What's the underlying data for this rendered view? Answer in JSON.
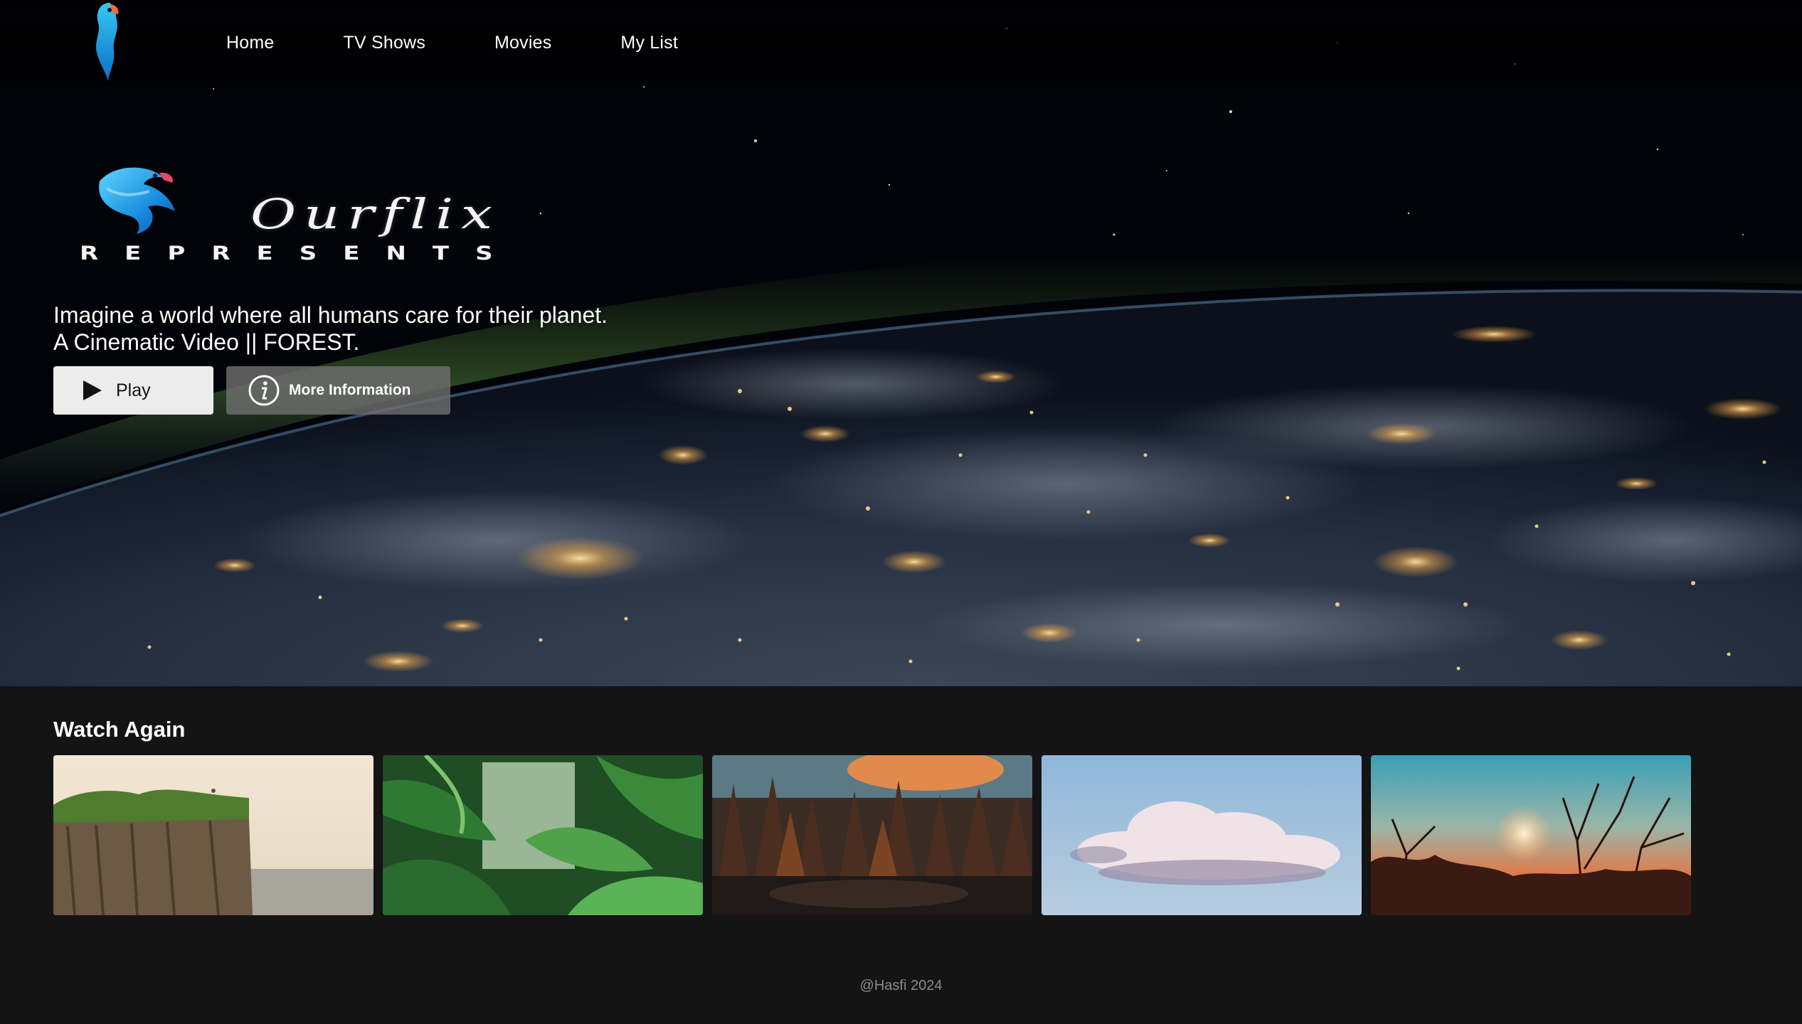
{
  "nav": {
    "logo_icon": "parrot-logo-icon",
    "links": [
      {
        "label": "Home"
      },
      {
        "label": "TV Shows"
      },
      {
        "label": "Movies"
      },
      {
        "label": "My List"
      }
    ]
  },
  "hero": {
    "brand_icon": "parrot-bird-icon",
    "brand_name": "Ourflix",
    "brand_tag": "REPRESENTS",
    "tagline_line1": "Imagine a world where all humans care for their planet.",
    "tagline_line2": "A Cinematic Video || FOREST.",
    "play_label": "Play",
    "info_label": "More Information",
    "play_icon": "play-icon",
    "info_icon": "info-icon"
  },
  "watch_again": {
    "title": "Watch Again",
    "items": [
      {
        "name": "cliff-ocean-thumbnail"
      },
      {
        "name": "jungle-leaves-thumbnail"
      },
      {
        "name": "autumn-forest-lake-thumbnail"
      },
      {
        "name": "cloud-sky-thumbnail"
      },
      {
        "name": "sunset-branches-thumbnail"
      }
    ]
  },
  "footer": {
    "text": "@Hasfi 2024"
  },
  "colors": {
    "page_bg": "#141414",
    "play_button_bg": "#ececec",
    "info_button_bg": "#6e6e6e",
    "brand_blue": "#1fa4e6",
    "footer_text": "#8a8a8a"
  }
}
